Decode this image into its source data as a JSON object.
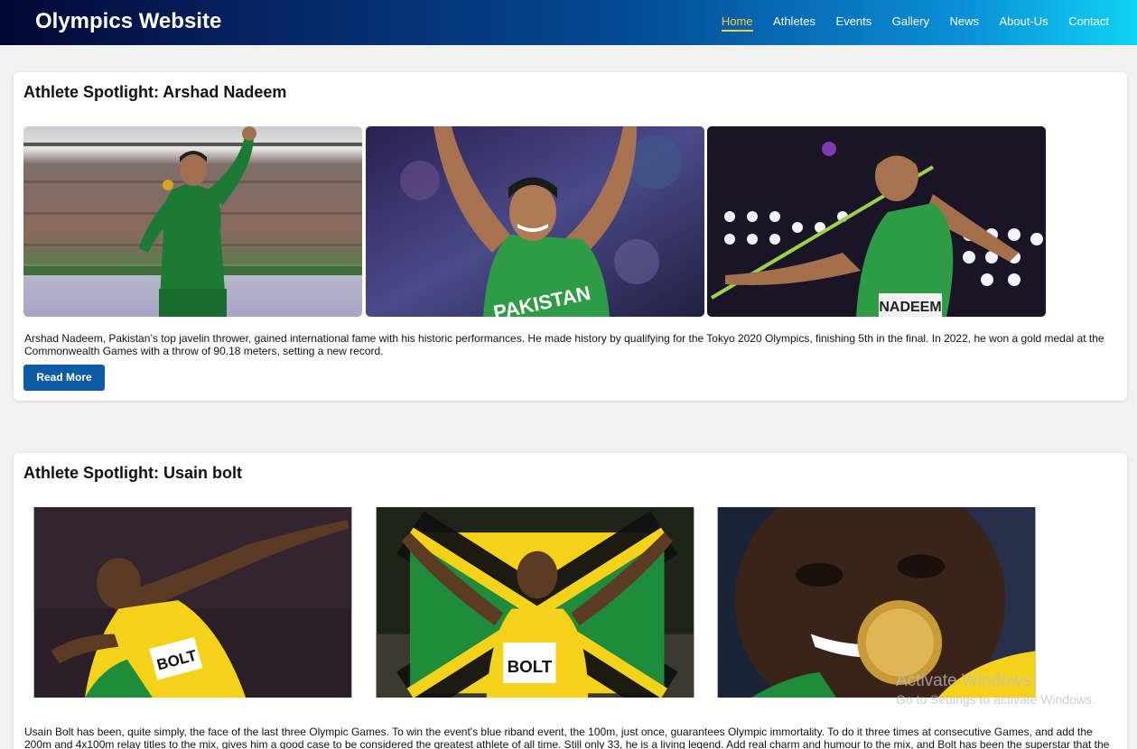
{
  "brand": "Olympics Website",
  "nav": {
    "items": [
      "Home",
      "Athletes",
      "Events",
      "Gallery",
      "News",
      "About-Us",
      "Contact"
    ],
    "active": "Home",
    "active_color": "#f3cf38"
  },
  "spotlights": [
    {
      "title": "Athlete Spotlight: Arshad Nadeem",
      "photos": [
        {
          "icon": "athlete-medal-stadium-photo",
          "jersey_text": ""
        },
        {
          "icon": "athlete-celebrating-photo",
          "jersey_text": "PAKISTAN"
        },
        {
          "icon": "athlete-javelin-throw-photo",
          "jersey_text": "NADEEM"
        }
      ],
      "description": "Arshad Nadeem, Pakistan’s top javelin thrower, gained international fame with his historic performances. He made history by qualifying for the Tokyo 2020 Olympics, finishing 5th in the final. In 2022, he won a gold medal at the Commonwealth Games with a throw of 90.18 meters, setting a new record.",
      "button": "Read More"
    },
    {
      "title": "Athlete Spotlight: Usain bolt",
      "photos": [
        {
          "icon": "athlete-lightning-pose-photo",
          "jersey_text": "BOLT"
        },
        {
          "icon": "athlete-with-flag-photo",
          "jersey_text": "BOLT"
        },
        {
          "icon": "athlete-biting-medal-photo",
          "jersey_text": ""
        }
      ],
      "description": "Usain Bolt has been, quite simply, the face of the last three Olympic Games. To win the event's blue riband event, the 100m, just once, guarantees Olympic immortality. To do it three times at consecutive Games, and add the 200m and 4x100m relay titles to the mix, gives him a good case to be considered the greatest athlete of all time. Still only 33, he is a living legend. Add real charm and humour to the mix, and Bolt has been the superstar that the"
    }
  ],
  "watermark": {
    "line1": "Activate Windows",
    "line2": "Go to Settings to activate Windows."
  },
  "colors": {
    "button": "#0d5aa7",
    "nav_gradient_start": "#020733",
    "nav_gradient_end": "#10d2f5"
  }
}
